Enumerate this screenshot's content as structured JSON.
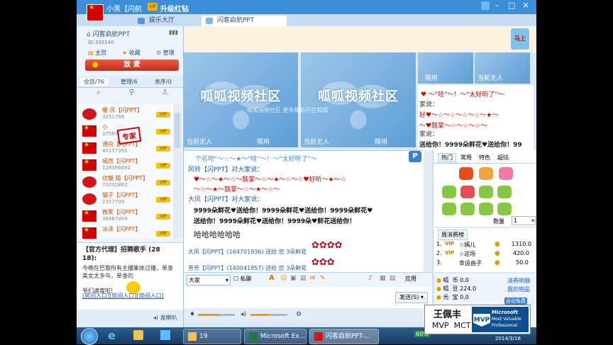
{
  "title": {
    "user": "小黑【闪航",
    "upgrade": "升级红钻",
    "window_controls": [
      "–",
      "□",
      "×"
    ]
  },
  "tabs": [
    {
      "label": "娱乐大厅"
    },
    {
      "label": "闪客启航PPT"
    }
  ],
  "room": {
    "name": "闪客启航PPT",
    "id": "ID:335140",
    "menu": [
      "主页",
      "收藏",
      "管理"
    ],
    "mic_button": "放 麦",
    "filters": [
      "全部/76",
      "管理/6",
      "表序/0"
    ]
  },
  "users": [
    {
      "name": "暖 风【闪PPT】",
      "id": "3251788"
    },
    {
      "name": "小",
      "id": "375890"
    },
    {
      "name": "通向【闪PPT】",
      "id": "40137391"
    },
    {
      "name": "嫣然【闪PPT】",
      "id": "128186691"
    },
    {
      "name": "纹魅 猫【闪PPT】",
      "id": "71032862"
    },
    {
      "name": "猫子【闪PPT】",
      "id": "2357709"
    },
    {
      "name": "微笑【闪PPT】",
      "id": "36487404"
    },
    {
      "name": "冰泽【闪PPT】",
      "id": ""
    }
  ],
  "specialist_stamp": "专家",
  "announcement": {
    "title": "【官方代理】招聘歌手 (28 18):",
    "body": "今晚在巴黎所有主播集体过播，单身美女太多鸟，单身的",
    "link_line": "爷们速度啦!",
    "links": "[房间入口][房间入口][房间入口]"
  },
  "bottom_left": {
    "speaker_label": "发喇叭"
  },
  "videos": [
    {
      "watermark": "呱呱视频社区",
      "footer_left": "当前无人",
      "footer_right": "限用"
    },
    {
      "watermark": "呱呱视频社区",
      "footer_left": "当前无人",
      "footer_right": "限用"
    }
  ],
  "small_videos": [
    {
      "label": "限用"
    },
    {
      "label": "当前无人"
    }
  ],
  "video_overlay": "呱呱视频社区 更多精彩尽在呱呱",
  "top_right_ad": "马上",
  "side_chat": [
    "♥ ～\"哇\"～！～\"太好听了\"～",
    "家说：",
    "好♥～☆～☆～☆～☆～★～",
    "～♥鼓掌～☆～☆～☆～",
    "家说：",
    "送给你！9999朵鲜花♥送给你！99"
  ],
  "main_chat": {
    "header": "个名吧\"～☆～★～\"哇\"～！～\"太好听了\"～",
    "lines": [
      "风铃【闪PPT】对大家说：",
      "♥～☆～★～☆～鼓掌～☆～★～☆～☆♥好听～★～☆",
      "～☆～★～鼓掌～☆～★～☆～",
      "大凤【闪PPT】对大家说：",
      "9999朵鲜花♥送给你！9999朵鲜花♥送给你！9999朵鲜花♥",
      "送给你！9999朵鲜花♥送给你！9999朵♥鲜花送给你！"
    ],
    "big_text": "哈哈哈哈哈哈",
    "gift_lines": [
      "大凤【闪PPT】(164701936) 送给 您 3朵鲜花",
      "芳芳【闪PPT】(140041857) 送给 您 3朵鲜花"
    ]
  },
  "input_bar": {
    "target": "大家",
    "private_label": "私聊",
    "app_label": "应用",
    "send_label": "发送(S)"
  },
  "gift_panel": {
    "tabs": [
      "热门",
      "常用",
      "特色",
      "超炫"
    ],
    "quantity_label": "数量",
    "quantity_value": "1"
  },
  "ranking": {
    "title": "周消费榜",
    "rows": [
      {
        "rank": "1.",
        "name": "☆嫣儿",
        "value": "1310.0"
      },
      {
        "rank": "2.",
        "name": "☆这场",
        "value": "420.0"
      },
      {
        "rank": "3.",
        "name": "幸运由子",
        "value": "50.0"
      }
    ]
  },
  "wallet": {
    "rows": [
      {
        "label": "呱",
        "unit": "币",
        "value": "0.0"
      },
      {
        "label": "呱",
        "unit": "豆",
        "value": "224.0"
      },
      {
        "label": "元",
        "unit": "宝",
        "value": "0.0"
      }
    ],
    "links": [
      "消费明细",
      "我的物品",
      "自动免费"
    ]
  },
  "watermark_badge": {
    "name": "王佩丰",
    "titles": "MVP  MCT",
    "logo_line1": "Microsoft",
    "logo_line2": "Most Valuable",
    "logo_line3": "Professional",
    "logo_abbrev": "MVP"
  },
  "taskbar": {
    "items": [
      "19",
      "Microsoft Ex...",
      "闪客启航PPT-..."
    ],
    "tray": "60%",
    "date": "2014/3/16"
  },
  "colors": {
    "title_bar": "#3b8fd6",
    "mic_button": "#e0331e",
    "vip": "#f5a000"
  }
}
